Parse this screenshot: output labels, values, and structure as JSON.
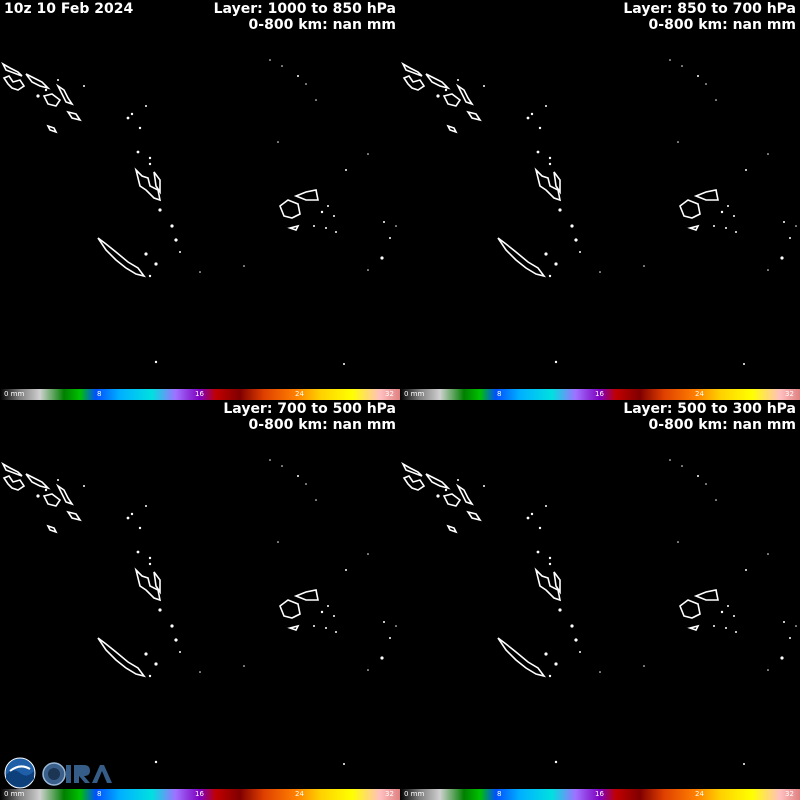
{
  "datetime": "10z 10 Feb 2024",
  "panels": [
    {
      "layer": "Layer: 1000 to 850 hPa",
      "summary": "0-800 km: nan mm"
    },
    {
      "layer": "Layer: 850 to 700 hPa",
      "summary": "0-800 km: nan mm"
    },
    {
      "layer": "Layer: 700 to 500 hPa",
      "summary": "0-800 km: nan mm"
    },
    {
      "layer": "Layer: 500 to 300 hPa",
      "summary": "0-800 km: nan mm"
    }
  ],
  "colorbar": {
    "unit_label": "0 mm",
    "ticks": [
      "8",
      "16",
      "24",
      "32"
    ],
    "colors": [
      "#000000",
      "#808080",
      "#d0d0d0",
      "#008000",
      "#00c000",
      "#0050ff",
      "#00b0ff",
      "#00e0e0",
      "#a070ff",
      "#8000c0",
      "#c00000",
      "#800000",
      "#e04000",
      "#ff8000",
      "#ffd000",
      "#ffff00",
      "#ffc0c0",
      "#e08080"
    ]
  },
  "logos": [
    "noaa-logo",
    "cira-logo"
  ]
}
